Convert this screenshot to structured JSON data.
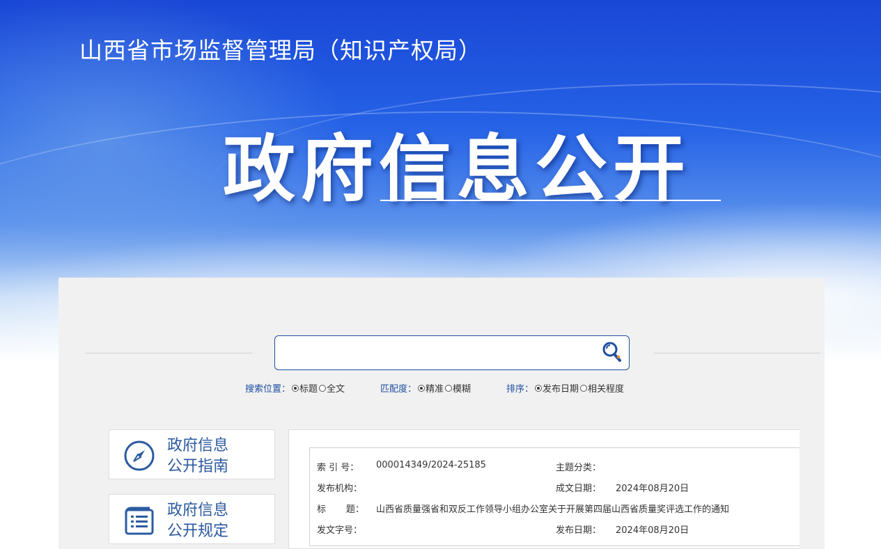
{
  "header": {
    "org_title": "山西省市场监督管理局（知识产权局）",
    "main_title": "政府信息公开"
  },
  "search": {
    "placeholder": "",
    "position_label": "搜索位置：",
    "position_options": [
      "标题",
      "全文"
    ],
    "position_selected": "标题",
    "match_label": "匹配度：",
    "match_options": [
      "精准",
      "模糊"
    ],
    "match_selected": "精准",
    "sort_label": "排序：",
    "sort_options": [
      "发布日期",
      "相关程度"
    ],
    "sort_selected": "发布日期"
  },
  "sidebar": {
    "items": [
      {
        "line1": "政府信息",
        "line2": "公开指南",
        "icon": "compass-icon"
      },
      {
        "line1": "政府信息",
        "line2": "公开规定",
        "icon": "document-list-icon"
      }
    ]
  },
  "document_info": {
    "index_label": "索  引 号：",
    "index_value": "000014349/2024-25185",
    "topic_label": "主题分类：",
    "topic_value": "",
    "publisher_label": "发布机构：",
    "publisher_value": "",
    "created_label": "成文日期：",
    "created_value": "2024年08月20日",
    "title_label": "标       题：",
    "title_value": "山西省质量强省和双反工作领导小组办公室关于开展第四届山西省质量奖评选工作的通知",
    "docno_label": "发文字号：",
    "docno_value": "",
    "published_label": "发布日期：",
    "published_value": "2024年08月20日"
  },
  "colors": {
    "banner_blue": "#2562e6",
    "accent_blue": "#1f4ea0",
    "panel_gray": "#f1f1f1"
  }
}
